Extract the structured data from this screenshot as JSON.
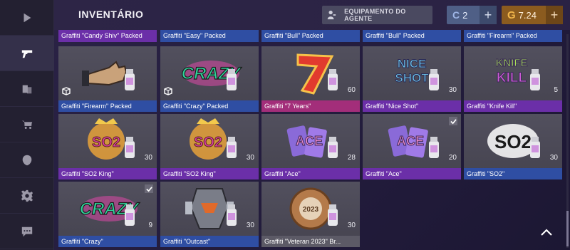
{
  "header": {
    "title": "INVENTÁRIO",
    "agent_button": "EQUIPAMENTO DO AGENTE",
    "credits": {
      "symbol": "C",
      "value": "2"
    },
    "gold": {
      "symbol": "G",
      "value": "7.24"
    },
    "plus": "+"
  },
  "sidebar": {
    "items": [
      {
        "name": "play-icon",
        "active": false
      },
      {
        "name": "pistol-icon",
        "active": true
      },
      {
        "name": "cards-icon",
        "active": false
      },
      {
        "name": "cart-icon",
        "active": false
      },
      {
        "name": "clan-icon",
        "active": false
      },
      {
        "name": "gear-icon",
        "active": false
      },
      {
        "name": "chat-icon",
        "active": false
      }
    ]
  },
  "top_row": [
    {
      "name": "Graffiti \"Candy Shiv\" Packed",
      "rarity": "purple"
    },
    {
      "name": "Graffiti \"Easy\" Packed",
      "rarity": "blue"
    },
    {
      "name": "Graffiti \"Bull\" Packed",
      "rarity": "blue"
    },
    {
      "name": "Graffiti \"Bull\" Packed",
      "rarity": "blue"
    },
    {
      "name": "Graffiti \"Firearm\" Packed",
      "rarity": "blue"
    }
  ],
  "items": [
    {
      "name": "Graffiti \"Firearm\" Packed",
      "qty": "",
      "rarity": "blue",
      "packed": true,
      "checked": false,
      "art": "hand"
    },
    {
      "name": "Graffiti \"Crazy\" Packed",
      "qty": "",
      "rarity": "blue",
      "packed": true,
      "checked": false,
      "art": "crazy"
    },
    {
      "name": "Graffiti \"7 Years\"",
      "qty": "60",
      "rarity": "pink",
      "packed": false,
      "checked": false,
      "art": "seven"
    },
    {
      "name": "Graffiti \"Nice Shot\"",
      "qty": "30",
      "rarity": "purple",
      "packed": false,
      "checked": false,
      "art": "niceshot"
    },
    {
      "name": "Graffiti \"Knife Kill\"",
      "qty": "5",
      "rarity": "purple",
      "packed": false,
      "checked": false,
      "art": "knife"
    },
    {
      "name": "Graffiti \"SO2 King\"",
      "qty": "30",
      "rarity": "purple",
      "packed": false,
      "checked": false,
      "art": "so2king"
    },
    {
      "name": "Graffiti \"SO2 King\"",
      "qty": "30",
      "rarity": "purple",
      "packed": false,
      "checked": false,
      "art": "so2king"
    },
    {
      "name": "Graffiti \"Ace\"",
      "qty": "28",
      "rarity": "purple",
      "packed": false,
      "checked": false,
      "art": "ace"
    },
    {
      "name": "Graffiti \"Ace\"",
      "qty": "20",
      "rarity": "purple",
      "packed": false,
      "checked": true,
      "art": "ace"
    },
    {
      "name": "Graffiti \"SO2\"",
      "qty": "30",
      "rarity": "blue",
      "packed": false,
      "checked": false,
      "art": "so2"
    },
    {
      "name": "Graffiti \"Crazy\"",
      "qty": "9",
      "rarity": "blue",
      "packed": false,
      "checked": true,
      "art": "crazy"
    },
    {
      "name": "Graffiti \"Outcast\"",
      "qty": "30",
      "rarity": "blue",
      "packed": false,
      "checked": false,
      "art": "outcast"
    },
    {
      "name": "Graffiti \"Veteran 2023\" Br...",
      "qty": "30",
      "rarity": "grey",
      "packed": false,
      "checked": false,
      "art": "veteran"
    }
  ]
}
